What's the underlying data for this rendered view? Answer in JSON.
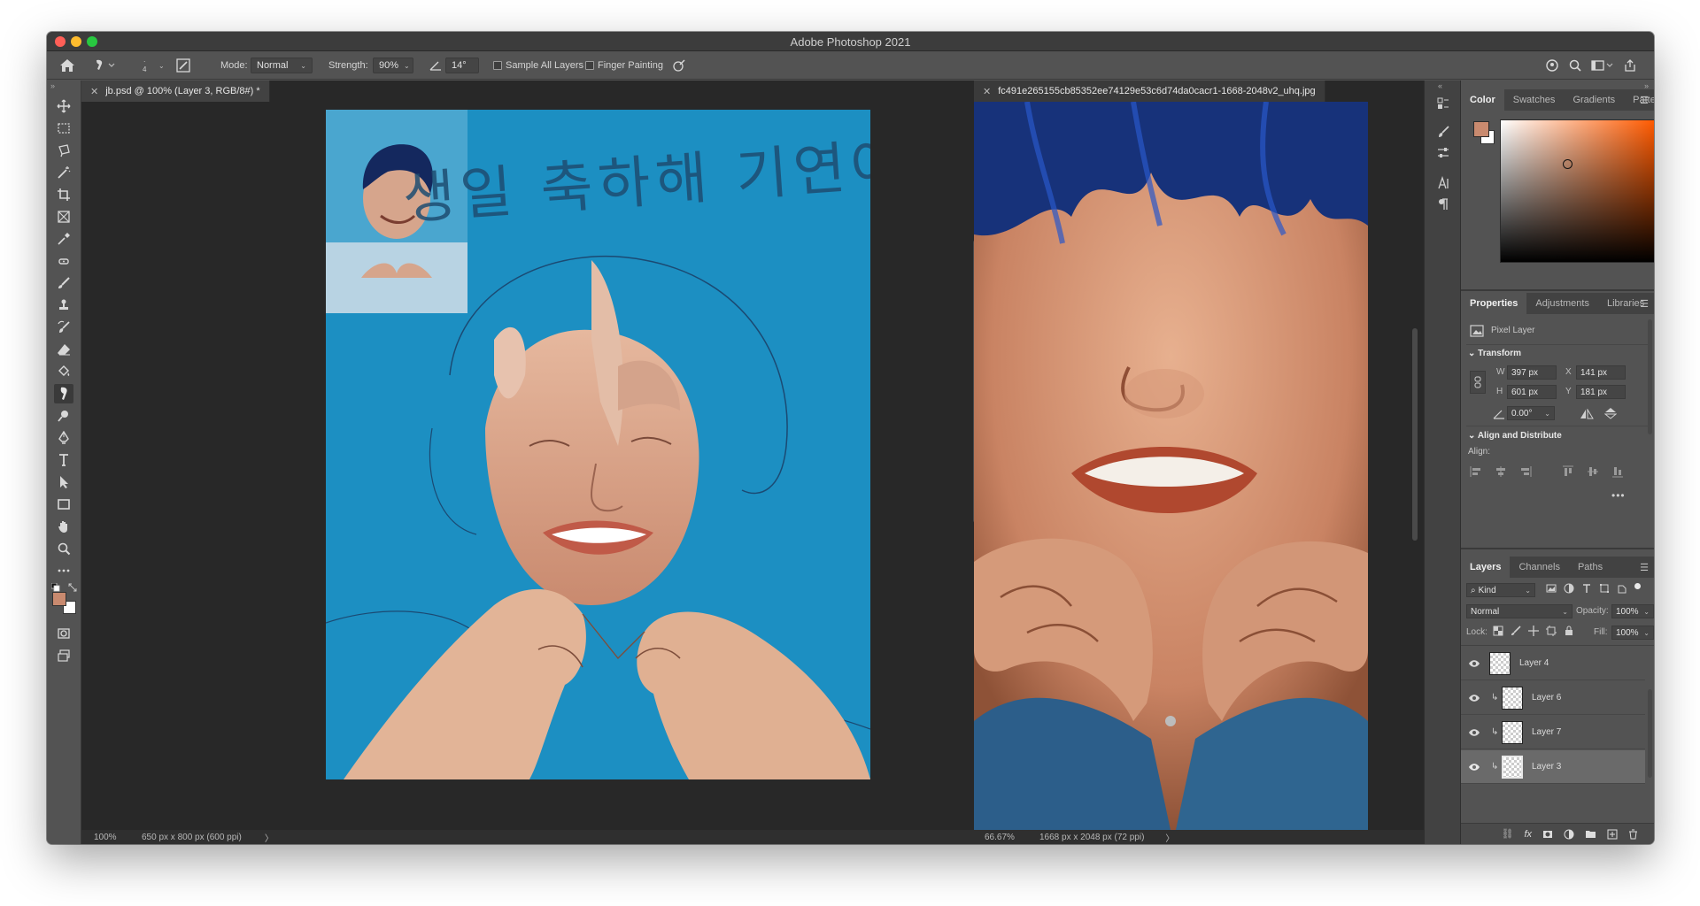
{
  "app": {
    "title": "Adobe Photoshop 2021"
  },
  "options": {
    "mode_label": "Mode:",
    "mode_value": "Normal",
    "brush_size": "4",
    "strength_label": "Strength:",
    "strength_value": "90%",
    "angle_value": "14°",
    "sample_all_layers": "Sample All Layers",
    "finger_painting": "Finger Painting"
  },
  "doc1": {
    "tab": "jb.psd @ 100% (Layer 3, RGB/8#) *",
    "zoom": "100%",
    "info": "650 px x 800 px (600 ppi)",
    "korean_text": "생일 축하해 기연아"
  },
  "doc2": {
    "tab": "fc491e265155cb85352ee74129e53c6d74da0cacr1-1668-2048v2_uhq.jpg",
    "zoom": "66.67%",
    "info": "1668 px x 2048 px (72 ppi)"
  },
  "color_panel": {
    "tabs": [
      "Color",
      "Swatches",
      "Gradients",
      "Patterns"
    ],
    "foreground": "#c98a6f"
  },
  "properties": {
    "tabs": [
      "Properties",
      "Adjustments",
      "Libraries"
    ],
    "type": "Pixel Layer",
    "transform_label": "Transform",
    "w_label": "W",
    "w": "397 px",
    "h_label": "H",
    "h": "601 px",
    "x_label": "X",
    "x": "141 px",
    "y_label": "Y",
    "y": "181 px",
    "angle": "0.00°",
    "align_section": "Align and Distribute",
    "align_label": "Align:"
  },
  "layers_panel": {
    "tabs": [
      "Layers",
      "Channels",
      "Paths"
    ],
    "filter": "Kind",
    "blend": "Normal",
    "opacity_label": "Opacity:",
    "opacity": "100%",
    "lock_label": "Lock:",
    "fill_label": "Fill:",
    "fill": "100%",
    "layers": [
      {
        "name": "Layer 4",
        "clipped": false,
        "selected": false
      },
      {
        "name": "Layer 6",
        "clipped": true,
        "selected": false
      },
      {
        "name": "Layer 7",
        "clipped": true,
        "selected": false
      },
      {
        "name": "Layer 3",
        "clipped": true,
        "selected": true
      }
    ]
  }
}
